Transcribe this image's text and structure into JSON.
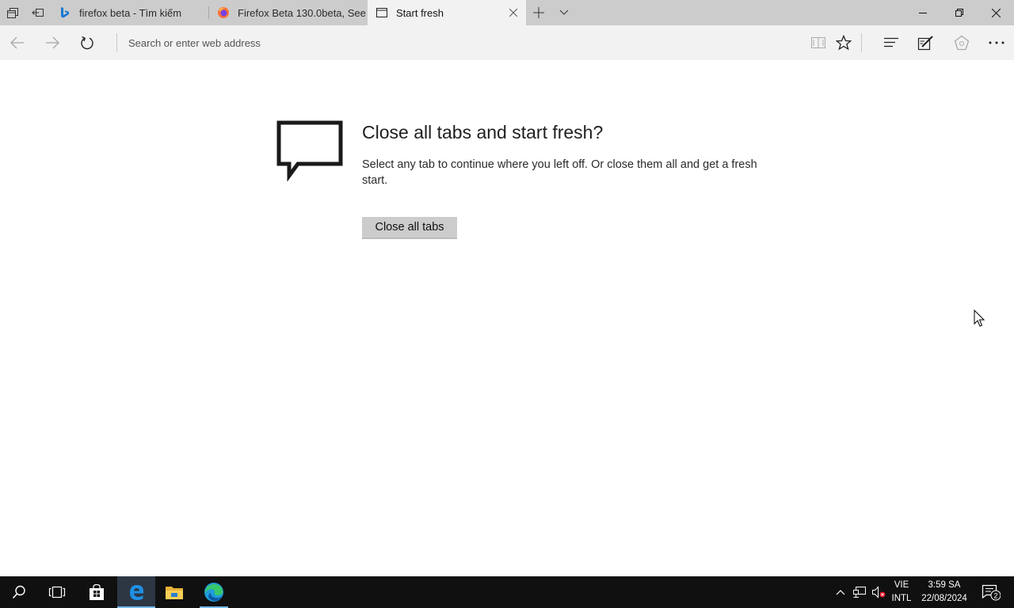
{
  "tabs": [
    {
      "title": "firefox beta - Tìm kiếm",
      "icon": "bing-icon",
      "active": false
    },
    {
      "title": "Firefox Beta 130.0beta, See",
      "icon": "firefox-icon",
      "active": false
    },
    {
      "title": "Start fresh",
      "icon": "page-icon",
      "active": true
    }
  ],
  "toolbar": {
    "address_placeholder": "Search or enter web address"
  },
  "page": {
    "headline": "Close all tabs and start fresh?",
    "description": "Select any tab to continue where you left off. Or close them all and get a fresh start.",
    "close_all_label": "Close all tabs"
  },
  "taskbar": {
    "pinned": [
      "search-icon",
      "task-view-icon",
      "store-icon",
      "edge-legacy-icon",
      "file-explorer-icon",
      "edge-chromium-icon"
    ],
    "lang_line1": "VIE",
    "lang_line2": "INTL",
    "time": "3:59 SA",
    "date": "22/08/2024",
    "notification_count": "2"
  },
  "colors": {
    "titlebar": "#cccccc",
    "toolbar": "#f2f2f2",
    "taskbar": "#101010",
    "accent": "#0078d7"
  }
}
